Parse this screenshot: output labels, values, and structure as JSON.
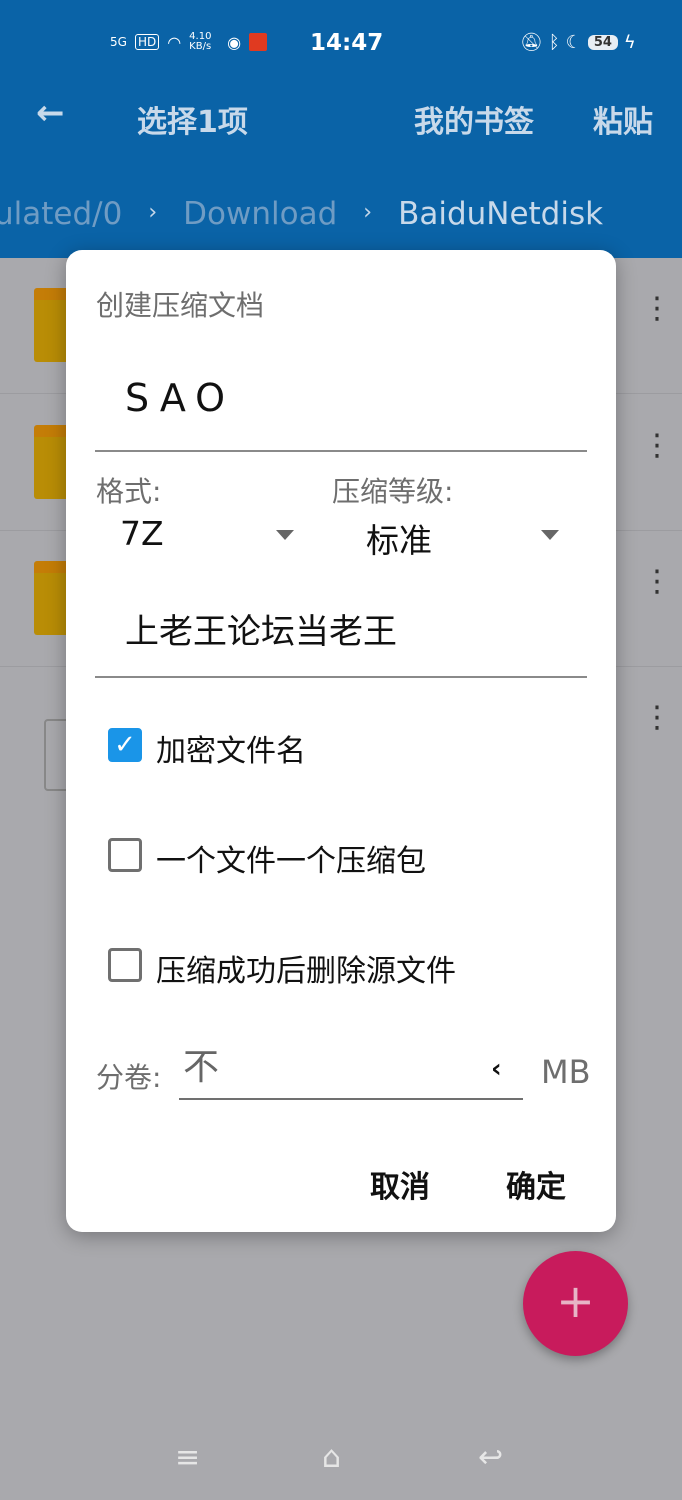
{
  "status": {
    "network": "5G",
    "hd": "HD",
    "speed": "4.10 KB/s",
    "time": "14:47",
    "battery": "54"
  },
  "appbar": {
    "title": "选择1项",
    "bookmarks": "我的书签",
    "paste": "粘贴"
  },
  "breadcrumb": [
    "ulated/0",
    "Download",
    "BaiduNetdisk"
  ],
  "dialog": {
    "title": "创建压缩文档",
    "archive_name": "SAO",
    "format_label": "格式:",
    "format_value": "7Z",
    "level_label": "压缩等级:",
    "level_value": "标准",
    "password": "上老王论坛当老王",
    "options": [
      {
        "label": "加密文件名",
        "checked": true
      },
      {
        "label": "一个文件一个压缩包",
        "checked": false
      },
      {
        "label": "压缩成功后删除源文件",
        "checked": false
      }
    ],
    "volume_label": "分卷:",
    "volume_value": "不",
    "volume_unit": "MB",
    "cancel": "取消",
    "ok": "确定"
  },
  "fab": "+",
  "colors": {
    "appbar": "#0a63a7",
    "checkbox": "#1a95e8",
    "fab": "#c81b5c"
  }
}
